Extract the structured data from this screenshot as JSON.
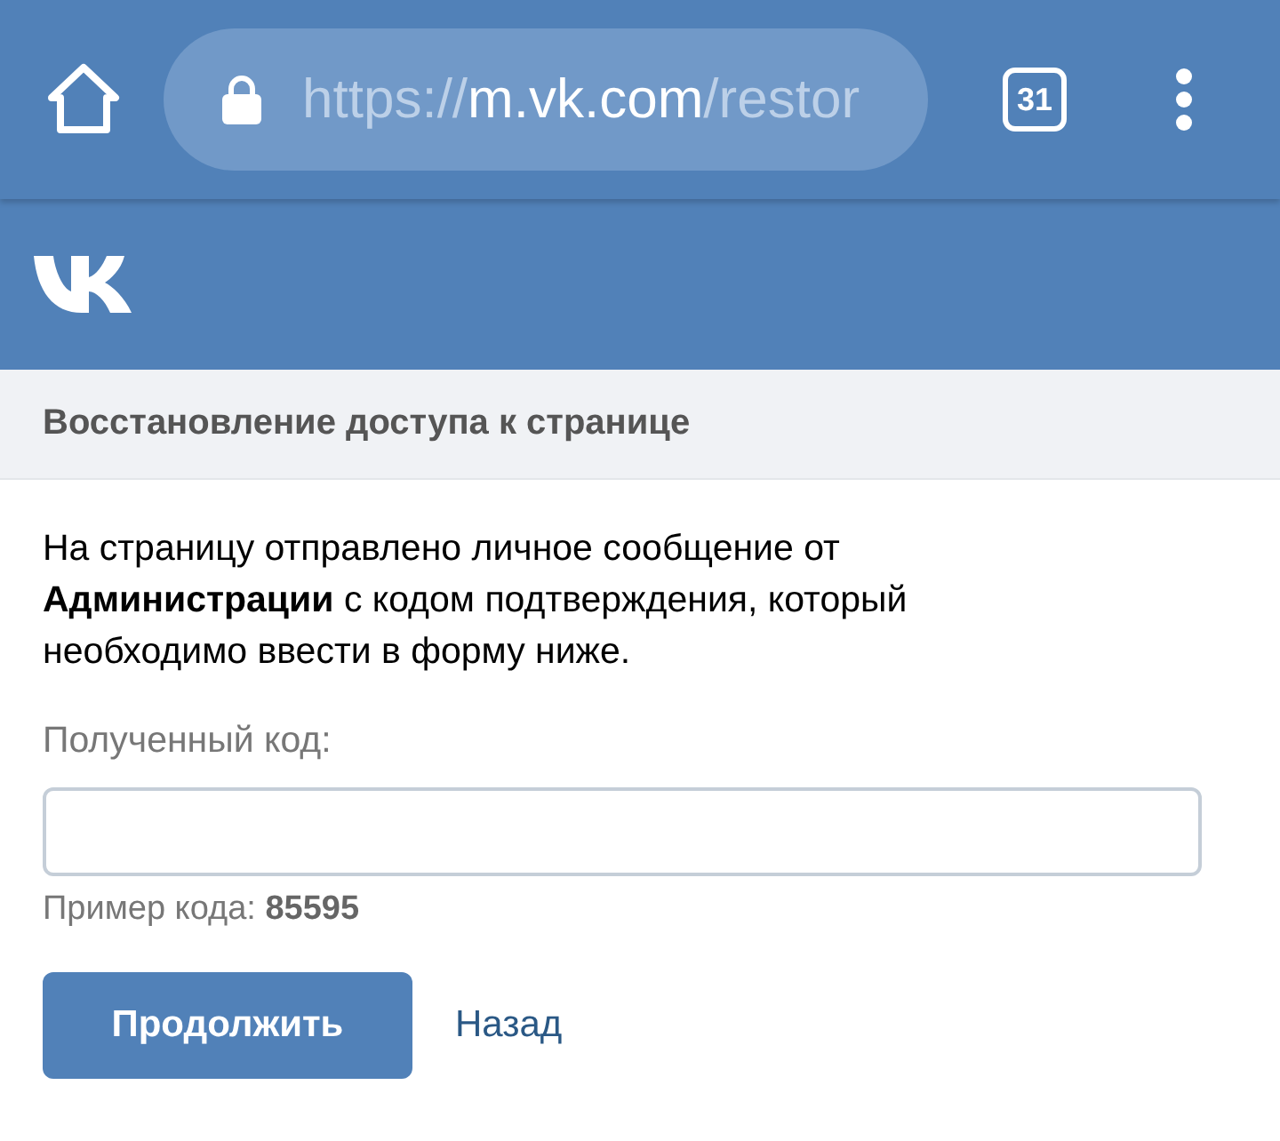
{
  "browser": {
    "url": {
      "scheme": "https://",
      "host": "m.vk.com",
      "path": "/restor"
    },
    "tab_count": "31"
  },
  "page": {
    "title": "Восстановление доступа к странице",
    "message": "На страницу отправлено личное сообщение от **Администрации** с кодом подтверждения, который необходимо ввести в форму ниже.",
    "code_field": {
      "label": "Полученный код:"
    },
    "hint": "Пример кода: **85595**",
    "buttons": [
      {
        "kind": "primary",
        "label": "Продолжить"
      },
      {
        "kind": "link",
        "label": "Назад"
      }
    ]
  }
}
